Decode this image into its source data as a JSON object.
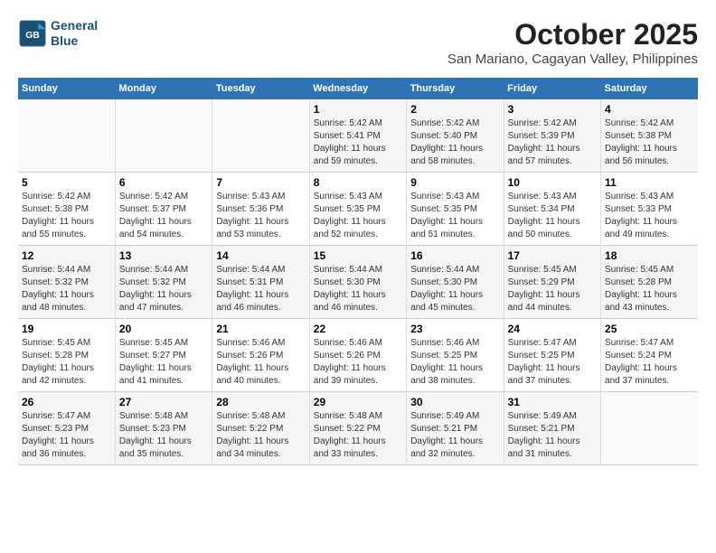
{
  "header": {
    "title": "October 2025",
    "subtitle": "San Mariano, Cagayan Valley, Philippines",
    "logo_line1": "General",
    "logo_line2": "Blue"
  },
  "days_of_week": [
    "Sunday",
    "Monday",
    "Tuesday",
    "Wednesday",
    "Thursday",
    "Friday",
    "Saturday"
  ],
  "weeks": [
    [
      {
        "day": "",
        "content": ""
      },
      {
        "day": "",
        "content": ""
      },
      {
        "day": "",
        "content": ""
      },
      {
        "day": "1",
        "content": "Sunrise: 5:42 AM\nSunset: 5:41 PM\nDaylight: 11 hours and 59 minutes."
      },
      {
        "day": "2",
        "content": "Sunrise: 5:42 AM\nSunset: 5:40 PM\nDaylight: 11 hours and 58 minutes."
      },
      {
        "day": "3",
        "content": "Sunrise: 5:42 AM\nSunset: 5:39 PM\nDaylight: 11 hours and 57 minutes."
      },
      {
        "day": "4",
        "content": "Sunrise: 5:42 AM\nSunset: 5:38 PM\nDaylight: 11 hours and 56 minutes."
      }
    ],
    [
      {
        "day": "5",
        "content": "Sunrise: 5:42 AM\nSunset: 5:38 PM\nDaylight: 11 hours and 55 minutes."
      },
      {
        "day": "6",
        "content": "Sunrise: 5:42 AM\nSunset: 5:37 PM\nDaylight: 11 hours and 54 minutes."
      },
      {
        "day": "7",
        "content": "Sunrise: 5:43 AM\nSunset: 5:36 PM\nDaylight: 11 hours and 53 minutes."
      },
      {
        "day": "8",
        "content": "Sunrise: 5:43 AM\nSunset: 5:35 PM\nDaylight: 11 hours and 52 minutes."
      },
      {
        "day": "9",
        "content": "Sunrise: 5:43 AM\nSunset: 5:35 PM\nDaylight: 11 hours and 51 minutes."
      },
      {
        "day": "10",
        "content": "Sunrise: 5:43 AM\nSunset: 5:34 PM\nDaylight: 11 hours and 50 minutes."
      },
      {
        "day": "11",
        "content": "Sunrise: 5:43 AM\nSunset: 5:33 PM\nDaylight: 11 hours and 49 minutes."
      }
    ],
    [
      {
        "day": "12",
        "content": "Sunrise: 5:44 AM\nSunset: 5:32 PM\nDaylight: 11 hours and 48 minutes."
      },
      {
        "day": "13",
        "content": "Sunrise: 5:44 AM\nSunset: 5:32 PM\nDaylight: 11 hours and 47 minutes."
      },
      {
        "day": "14",
        "content": "Sunrise: 5:44 AM\nSunset: 5:31 PM\nDaylight: 11 hours and 46 minutes."
      },
      {
        "day": "15",
        "content": "Sunrise: 5:44 AM\nSunset: 5:30 PM\nDaylight: 11 hours and 46 minutes."
      },
      {
        "day": "16",
        "content": "Sunrise: 5:44 AM\nSunset: 5:30 PM\nDaylight: 11 hours and 45 minutes."
      },
      {
        "day": "17",
        "content": "Sunrise: 5:45 AM\nSunset: 5:29 PM\nDaylight: 11 hours and 44 minutes."
      },
      {
        "day": "18",
        "content": "Sunrise: 5:45 AM\nSunset: 5:28 PM\nDaylight: 11 hours and 43 minutes."
      }
    ],
    [
      {
        "day": "19",
        "content": "Sunrise: 5:45 AM\nSunset: 5:28 PM\nDaylight: 11 hours and 42 minutes."
      },
      {
        "day": "20",
        "content": "Sunrise: 5:45 AM\nSunset: 5:27 PM\nDaylight: 11 hours and 41 minutes."
      },
      {
        "day": "21",
        "content": "Sunrise: 5:46 AM\nSunset: 5:26 PM\nDaylight: 11 hours and 40 minutes."
      },
      {
        "day": "22",
        "content": "Sunrise: 5:46 AM\nSunset: 5:26 PM\nDaylight: 11 hours and 39 minutes."
      },
      {
        "day": "23",
        "content": "Sunrise: 5:46 AM\nSunset: 5:25 PM\nDaylight: 11 hours and 38 minutes."
      },
      {
        "day": "24",
        "content": "Sunrise: 5:47 AM\nSunset: 5:25 PM\nDaylight: 11 hours and 37 minutes."
      },
      {
        "day": "25",
        "content": "Sunrise: 5:47 AM\nSunset: 5:24 PM\nDaylight: 11 hours and 37 minutes."
      }
    ],
    [
      {
        "day": "26",
        "content": "Sunrise: 5:47 AM\nSunset: 5:23 PM\nDaylight: 11 hours and 36 minutes."
      },
      {
        "day": "27",
        "content": "Sunrise: 5:48 AM\nSunset: 5:23 PM\nDaylight: 11 hours and 35 minutes."
      },
      {
        "day": "28",
        "content": "Sunrise: 5:48 AM\nSunset: 5:22 PM\nDaylight: 11 hours and 34 minutes."
      },
      {
        "day": "29",
        "content": "Sunrise: 5:48 AM\nSunset: 5:22 PM\nDaylight: 11 hours and 33 minutes."
      },
      {
        "day": "30",
        "content": "Sunrise: 5:49 AM\nSunset: 5:21 PM\nDaylight: 11 hours and 32 minutes."
      },
      {
        "day": "31",
        "content": "Sunrise: 5:49 AM\nSunset: 5:21 PM\nDaylight: 11 hours and 31 minutes."
      },
      {
        "day": "",
        "content": ""
      }
    ]
  ]
}
